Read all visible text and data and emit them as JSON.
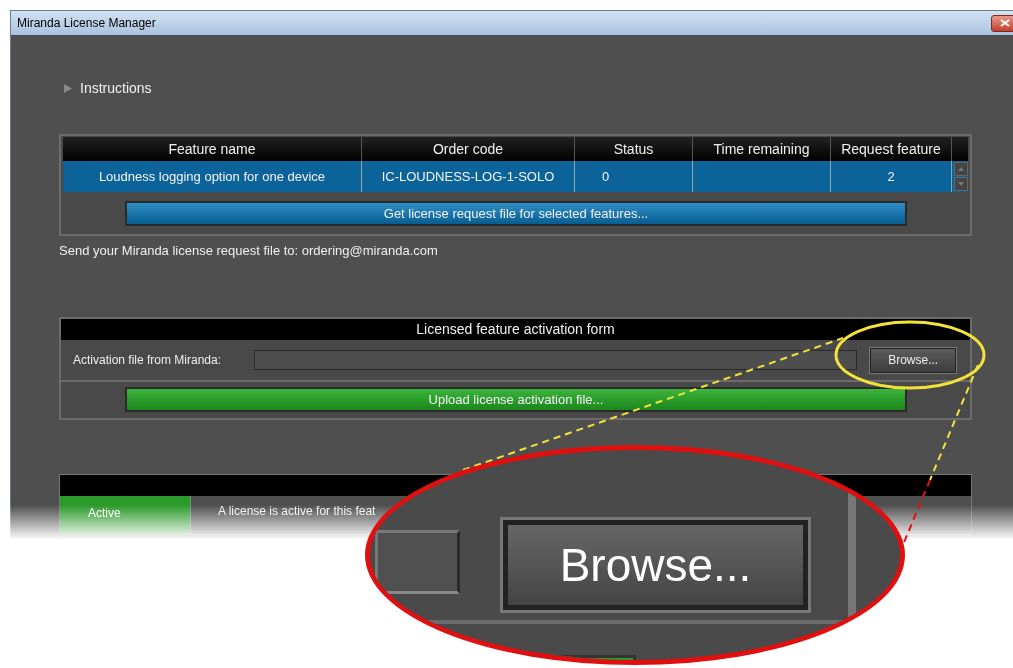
{
  "window": {
    "title": "Miranda License Manager"
  },
  "instructions": {
    "label": "Instructions",
    "expanded": false
  },
  "features_table": {
    "columns": [
      "Feature name",
      "Order code",
      "Status",
      "Time remaining",
      "Request feature"
    ],
    "rows": [
      {
        "feature_name": "Loudness logging option for one device",
        "order_code": "IC-LOUDNESS-LOG-1-SOLO",
        "status": "0",
        "request_feature": "2",
        "selected": true
      }
    ]
  },
  "request_button": "Get license request file for selected features...",
  "send_note": "Send your Miranda license request file to: ordering@miranda.com",
  "activation_form": {
    "title": "Licensed feature activation form",
    "file_label": "Activation file from Miranda:",
    "browse_button": "Browse...",
    "upload_button": "Upload license activation file..."
  },
  "legend": [
    {
      "label": "Active",
      "description": "A license is active for this feat",
      "color": "#2a9a2a"
    }
  ],
  "callout": {
    "label": "Browse..."
  }
}
